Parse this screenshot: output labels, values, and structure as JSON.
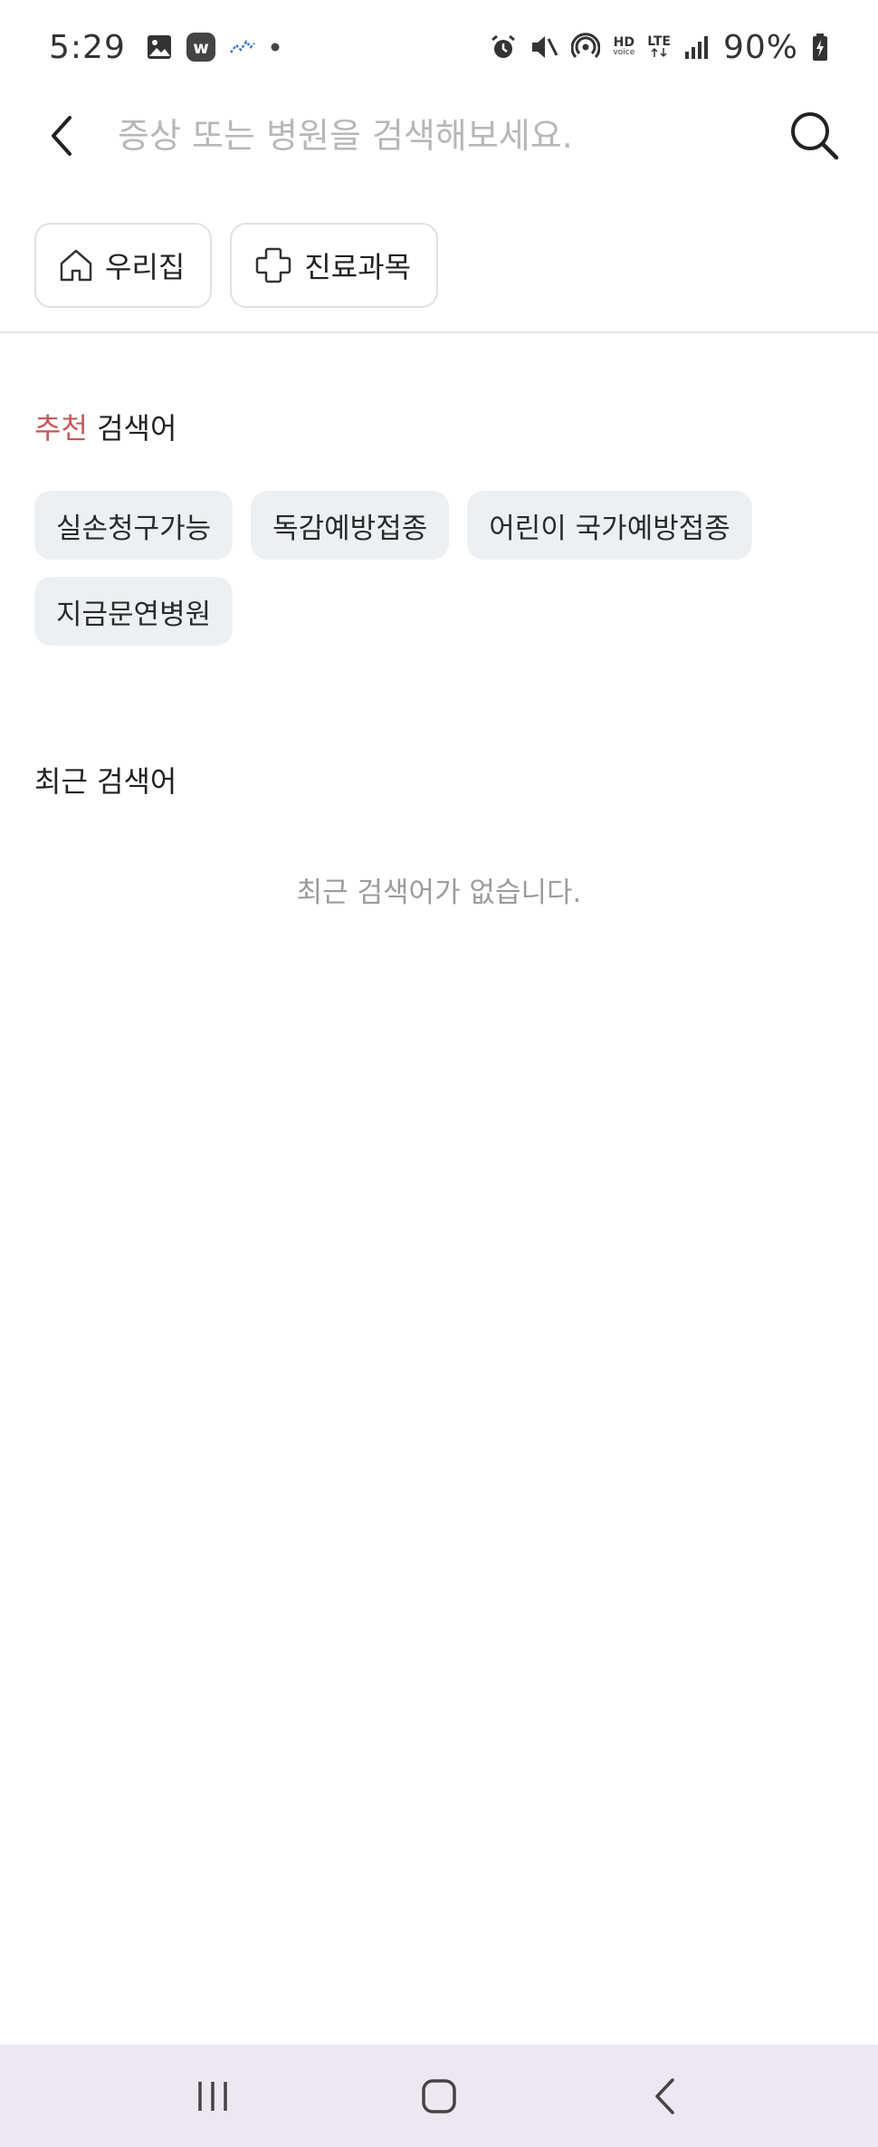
{
  "status_bar": {
    "time": "5:29",
    "left_icons": [
      "image-icon",
      "w-app-icon",
      "stock-chart-icon",
      "dot-icon"
    ],
    "right_icons": [
      "alarm-icon",
      "mute-icon",
      "hotspot-icon",
      "hd-voice-icon",
      "lte-icon",
      "signal-icon",
      "battery-charging-icon"
    ],
    "hd_label": "HD",
    "hd_sub": "voice",
    "lte_label": "LTE",
    "battery": "90%"
  },
  "header": {
    "search_placeholder": "증상 또는 병원을 검색해보세요.",
    "search_value": ""
  },
  "filters": {
    "home_label": "우리집",
    "department_label": "진료과목"
  },
  "recommended": {
    "title_accent": "추천",
    "title_rest": " 검색어",
    "keywords": [
      "실손청구가능",
      "독감예방접종",
      "어린이 국가예방접종",
      "지금문연병원"
    ]
  },
  "recent": {
    "title": "최근 검색어",
    "empty_message": "최근 검색어가 없습니다."
  },
  "colors": {
    "accent": "#c7585a",
    "chip_bg": "#edf0f3",
    "nav_bg": "#ede8f0"
  }
}
